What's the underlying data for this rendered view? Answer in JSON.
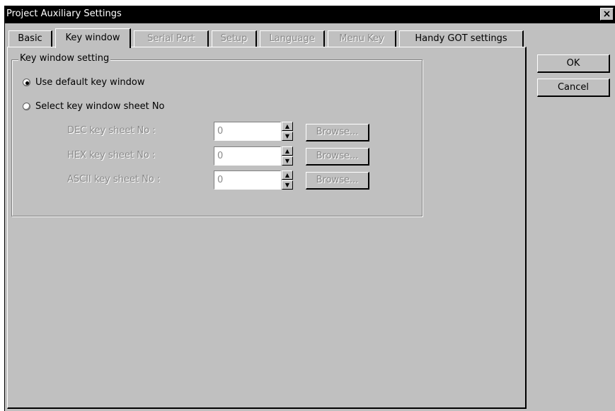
{
  "window": {
    "title": "Project Auxiliary Settings",
    "close_glyph": "×"
  },
  "tabs": [
    {
      "label": "Basic",
      "state": "normal"
    },
    {
      "label": "Key window",
      "state": "active"
    },
    {
      "label": "Serial Port",
      "state": "disabled"
    },
    {
      "label": "Setup",
      "state": "disabled"
    },
    {
      "label": "Language",
      "state": "disabled"
    },
    {
      "label": "Menu Key",
      "state": "disabled"
    },
    {
      "label": "Handy GOT settings",
      "state": "normal"
    }
  ],
  "group": {
    "title": "Key window setting",
    "radio_default": {
      "label": "Use default key window",
      "selected": true
    },
    "radio_select": {
      "label": "Select key window sheet No",
      "selected": false
    },
    "rows": [
      {
        "label": "DEC key sheet No :",
        "value": "0",
        "button": "Browse..."
      },
      {
        "label": "HEX key sheet No :",
        "value": "0",
        "button": "Browse..."
      },
      {
        "label": "ASCII key sheet No :",
        "value": "0",
        "button": "Browse..."
      }
    ]
  },
  "buttons": {
    "ok": "OK",
    "cancel": "Cancel"
  },
  "icons": {
    "spin_up": "▲",
    "spin_down": "▼"
  },
  "colors": {
    "face": "#c0c0c0",
    "title_bar": "#000000",
    "disabled_text": "#8a8a8a"
  }
}
